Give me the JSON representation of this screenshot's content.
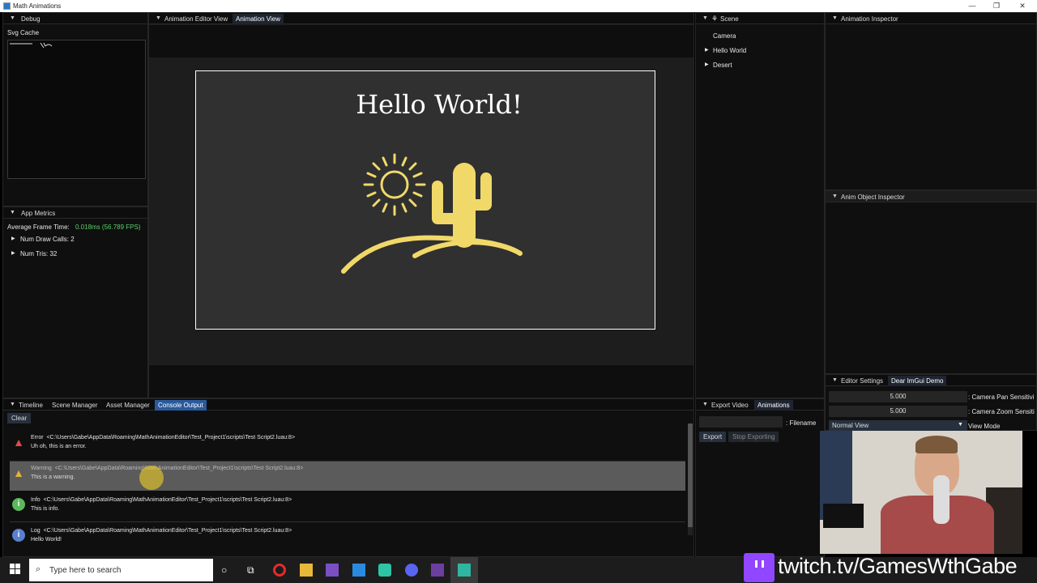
{
  "window": {
    "title": "Math Animations",
    "minimize": "—",
    "maximize": "❐",
    "close": "✕"
  },
  "debug": {
    "tab": "Debug",
    "svg_cache_label": "Svg Cache"
  },
  "metrics": {
    "tab": "App Metrics",
    "frame_label": "Average Frame Time:",
    "frame_value": "0.018ms (56.789 FPS)",
    "draw_calls": "Num Draw Calls: 2",
    "tris": "Num Tris: 32"
  },
  "editor_tabs": [
    "Animation Editor View",
    "Animation View"
  ],
  "canvas": {
    "heading": "Hello World!",
    "color_accent": "#f1d969"
  },
  "scene": {
    "tab": "Scene",
    "items": [
      "Camera",
      "Hello World",
      "Desert"
    ]
  },
  "inspector": {
    "tab": "Animation Inspector"
  },
  "object_inspector": {
    "tab": "Anim Object Inspector"
  },
  "bottom_tabs": [
    "Timeline",
    "Scene Manager",
    "Asset Manager",
    "Console Output"
  ],
  "console": {
    "clear_label": "Clear",
    "entries": [
      {
        "level": "Error",
        "path": "<C:\\Users\\Gabe\\AppData\\Roaming\\MathAnimationEditor\\Test_Project1\\scripts\\Test Script2.luau:8>",
        "message": "Uh oh, this is an error."
      },
      {
        "level": "Warning",
        "path": "<C:\\Users\\Gabe\\AppData\\Roaming\\MathAnimationEditor\\Test_Project1\\scripts\\Test Script2.luau:8>",
        "message": "This is a warning."
      },
      {
        "level": "Info",
        "path": "<C:\\Users\\Gabe\\AppData\\Roaming\\MathAnimationEditor\\Test_Project1\\scripts\\Test Script2.luau:8>",
        "message": "This is info."
      },
      {
        "level": "Log",
        "path": "<C:\\Users\\Gabe\\AppData\\Roaming\\MathAnimationEditor\\Test_Project1\\scripts\\Test Script2.luau:8>",
        "message": "Hello World!"
      }
    ]
  },
  "export": {
    "tabs": [
      "Export Video",
      "Animations"
    ],
    "filename_label": ": Filename",
    "filename_value": "",
    "export_label": "Export",
    "stop_label": "Stop Exporting"
  },
  "settings": {
    "tabs": [
      "Editor Settings",
      "Dear ImGui Demo"
    ],
    "pan_value": "5.000",
    "pan_label": ": Camera Pan Sensitivi",
    "zoom_value": "5.000",
    "zoom_label": ": Camera Zoom Sensiti",
    "view_mode_value": "Normal View",
    "view_mode_label": "View Mode"
  },
  "taskbar": {
    "search_placeholder": "Type here to search"
  },
  "overlay": {
    "twitch_text": "twitch.tv/GamesWthGabe"
  }
}
